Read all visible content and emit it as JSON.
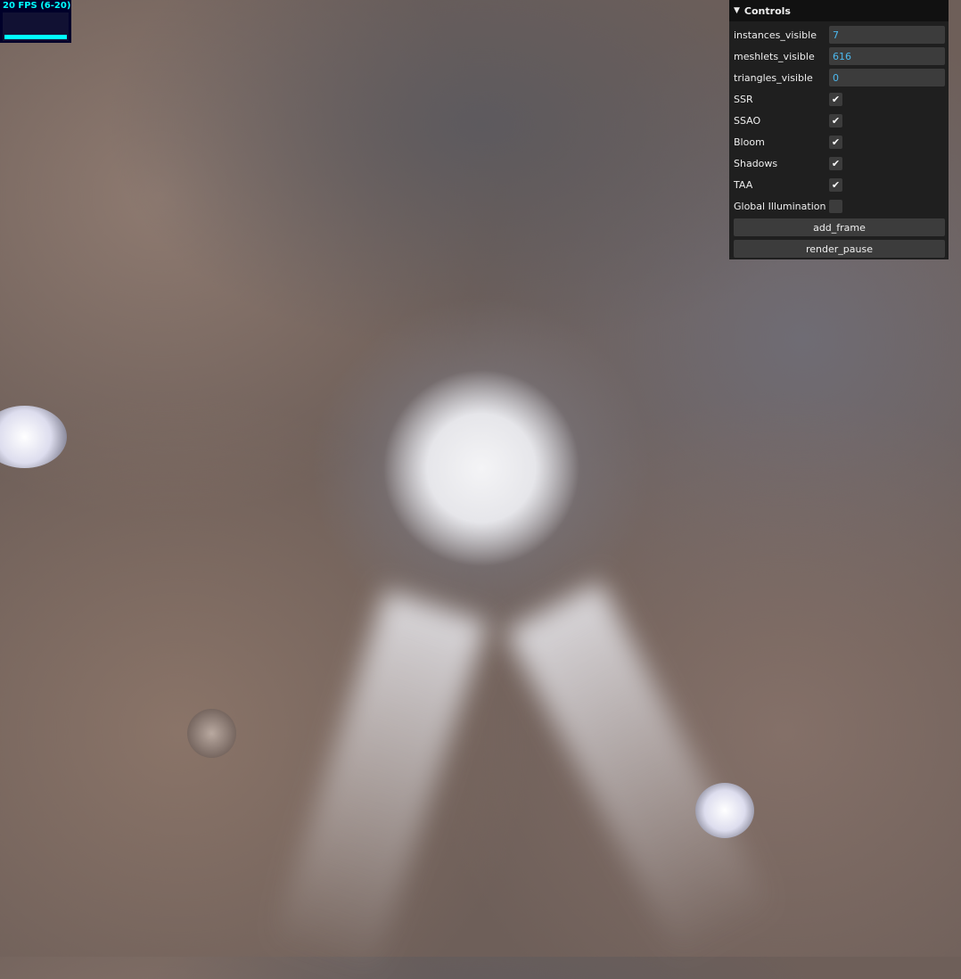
{
  "fps_meter": {
    "label": "20 FPS (6-20)",
    "fill_fraction": 0.95
  },
  "controls": {
    "title": "Controls",
    "fields": [
      {
        "label": "instances_visible",
        "value": "7"
      },
      {
        "label": "meshlets_visible",
        "value": "616"
      },
      {
        "label": "triangles_visible",
        "value": "0"
      }
    ],
    "toggles": [
      {
        "label": "SSR",
        "checked": true
      },
      {
        "label": "SSAO",
        "checked": true
      },
      {
        "label": "Bloom",
        "checked": true
      },
      {
        "label": "Shadows",
        "checked": true
      },
      {
        "label": "TAA",
        "checked": true
      },
      {
        "label": "Global Illumination",
        "checked": false
      }
    ],
    "buttons": [
      {
        "label": "add_frame"
      },
      {
        "label": "render_pause"
      }
    ]
  }
}
